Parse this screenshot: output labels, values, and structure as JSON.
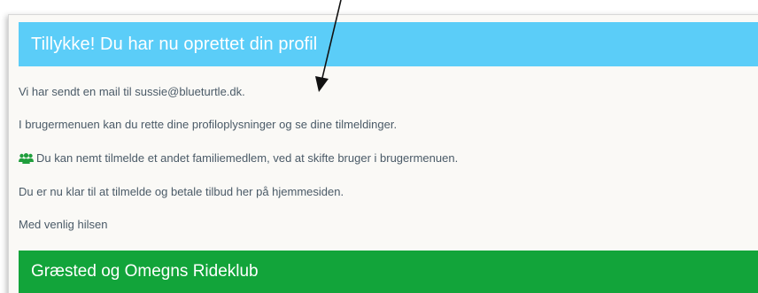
{
  "header": {
    "title": "Tillykke! Du har nu oprettet din profil"
  },
  "messages": {
    "mail_sent": "Vi har sendt en mail til sussie@blueturtle.dk.",
    "user_menu": "I brugermenuen kan du rette dine profiloplysninger og se dine tilmeldinger.",
    "family_member": "Du kan nemt tilmelde et andet familiemedlem, ved at skifte bruger i brugermenuen.",
    "ready": "Du er nu klar til at tilmelde og betale tilbud her på hjemmesiden.",
    "greeting": "Med venlig hilsen"
  },
  "footer": {
    "club_name": "Græsted og Omegns Rideklub"
  },
  "icons": {
    "family": "users-icon",
    "annotation": "arrow-annotation"
  },
  "colors": {
    "header_bg": "#5bcdf8",
    "footer_bg": "#12a43a",
    "icon_green": "#1f9e3c",
    "text": "#4a5a67"
  }
}
